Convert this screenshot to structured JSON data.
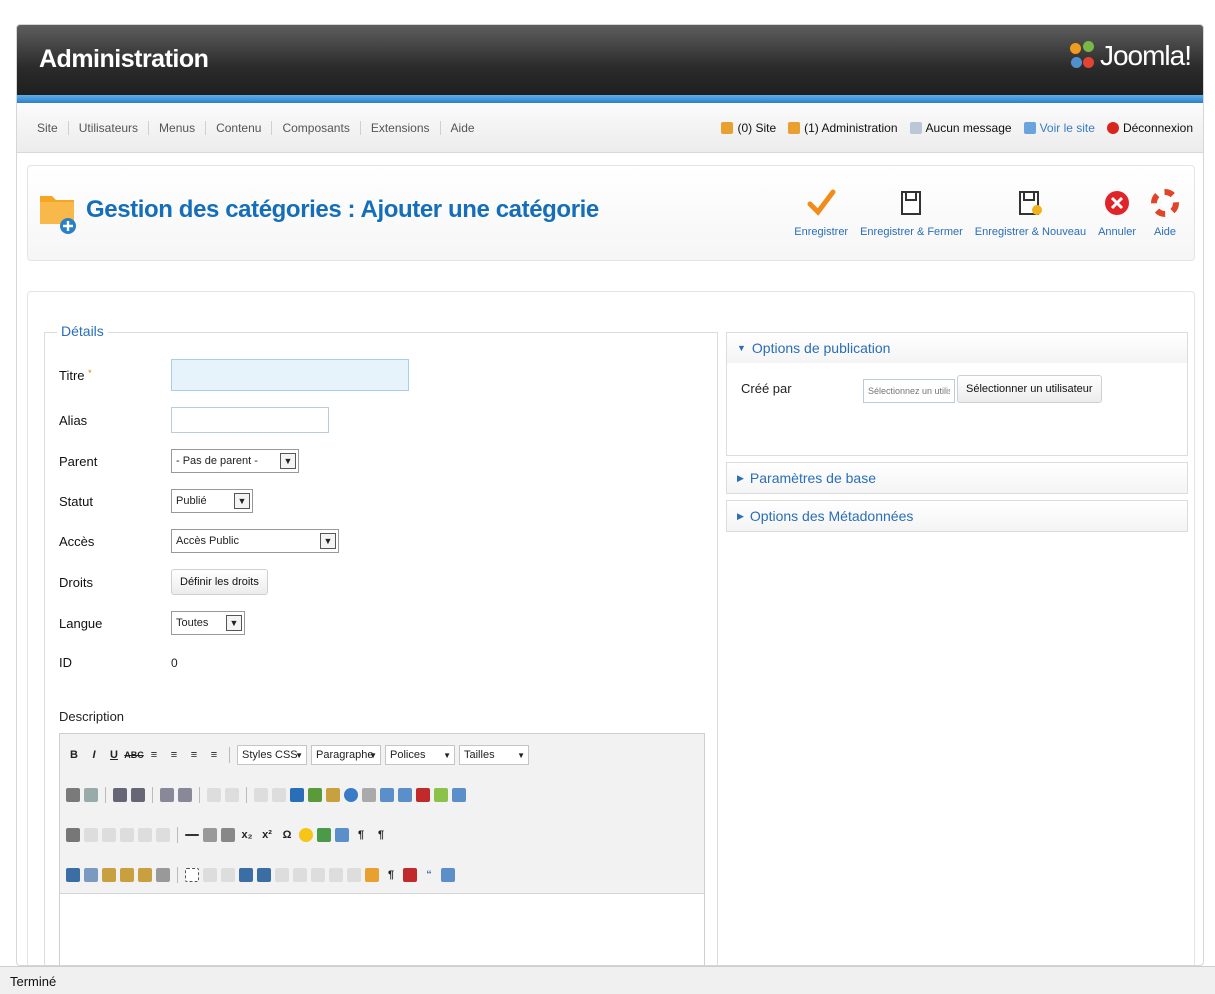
{
  "header": {
    "title": "Administration",
    "logo_text": "Joomla!"
  },
  "menu": {
    "items": [
      "Site",
      "Utilisateurs",
      "Menus",
      "Contenu",
      "Composants",
      "Extensions",
      "Aide"
    ]
  },
  "status": {
    "site": "(0) Site",
    "admin": "(1) Administration",
    "messages": "Aucun message",
    "view_site": "Voir le site",
    "logout": "Déconnexion"
  },
  "toolbar": {
    "page_title": "Gestion des catégories : Ajouter une catégorie",
    "buttons": {
      "save": "Enregistrer",
      "save_close": "Enregistrer & Fermer",
      "save_new": "Enregistrer & Nouveau",
      "cancel": "Annuler",
      "help": "Aide"
    }
  },
  "details": {
    "legend": "Détails",
    "title_label": "Titre",
    "alias_label": "Alias",
    "parent_label": "Parent",
    "parent_value": "- Pas de parent -",
    "status_label": "Statut",
    "status_value": "Publié",
    "access_label": "Accès",
    "access_value": "Accès Public",
    "rights_label": "Droits",
    "rights_button": "Définir les droits",
    "language_label": "Langue",
    "language_value": "Toutes",
    "id_label": "ID",
    "id_value": "0",
    "description_label": "Description"
  },
  "editor": {
    "styles": "Styles CSS",
    "format": "Paragraphe",
    "fonts": "Polices",
    "sizes": "Tailles"
  },
  "publishing": {
    "title": "Options de publication",
    "created_by_label": "Créé par",
    "user_placeholder": "Sélectionnez un utilisat",
    "select_user_button": "Sélectionner un utilisateur"
  },
  "panels": {
    "basic": "Paramètres de base",
    "metadata": "Options des Métadonnées"
  },
  "statusbar": {
    "text": "Terminé"
  },
  "colors": {
    "accent": "#146eb9",
    "header": "#2b2b2b",
    "strip": "#2b7fc9"
  }
}
